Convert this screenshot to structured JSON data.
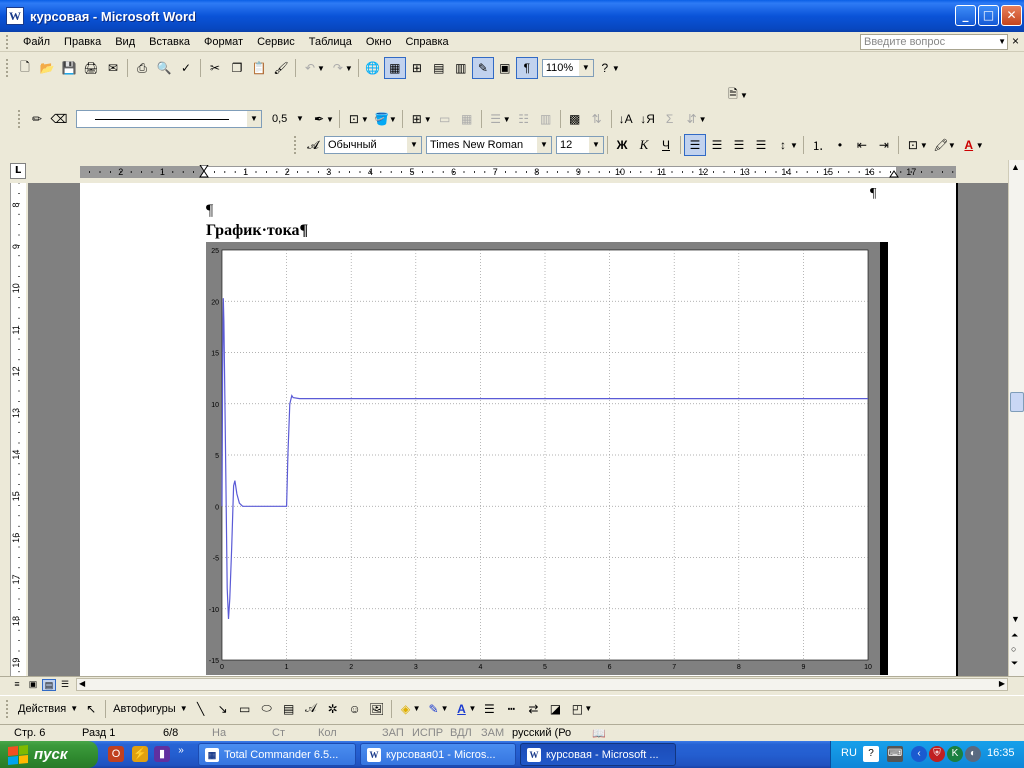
{
  "window": {
    "title": "курсовая - Microsoft Word",
    "controls": [
      "_",
      "□",
      "✕"
    ]
  },
  "menu": {
    "items": [
      "Файл",
      "Правка",
      "Вид",
      "Вставка",
      "Формат",
      "Сервис",
      "Таблица",
      "Окно",
      "Справка"
    ],
    "ask_placeholder": "Введите вопрос"
  },
  "toolbar_standard": {
    "zoom": "110%"
  },
  "toolbar_drawing_lines": {
    "line_weight": "0,5"
  },
  "toolbar_formatting": {
    "style": "Обычный",
    "font": "Times New Roman",
    "size": "12",
    "bold": "Ж",
    "italic": "К",
    "underline": "Ч"
  },
  "ruler": {
    "horizontal_labels": [
      "3",
      "2",
      "1",
      "1",
      "2",
      "3",
      "4",
      "5",
      "6",
      "7",
      "8",
      "9",
      "10",
      "11",
      "12",
      "13",
      "14",
      "15",
      "16",
      "17"
    ],
    "vertical_labels": [
      "8",
      "9",
      "10",
      "11",
      "12",
      "13",
      "14",
      "15",
      "16",
      "17",
      "18",
      "19"
    ]
  },
  "document": {
    "pilcrow": "¶",
    "heading": "График·тока¶"
  },
  "chart_data": {
    "type": "line",
    "xlim": [
      0,
      10
    ],
    "ylim": [
      -15,
      25
    ],
    "x_ticks": [
      "0",
      "1",
      "2",
      "3",
      "4",
      "5",
      "6",
      "7",
      "8",
      "9",
      "10"
    ],
    "y_ticks": [
      "25",
      "20",
      "15",
      "10",
      "5",
      "0",
      "-5",
      "-10",
      "-15"
    ],
    "grid": true,
    "line_color": "#5a5ad6",
    "series": [
      {
        "x": [
          0,
          0.01,
          0.02,
          0.03,
          0.05,
          0.08,
          0.1,
          0.12,
          0.15,
          0.18,
          0.2,
          0.23,
          0.27,
          0.32,
          0.4,
          0.6,
          1.0,
          1.02,
          1.05,
          1.08,
          1.1,
          1.2,
          1.5,
          3,
          5,
          7,
          10
        ],
        "y": [
          0,
          13,
          20.3,
          18,
          8,
          -8,
          -11,
          -9,
          -4,
          2,
          2.5,
          1.2,
          0.3,
          0,
          0,
          0,
          0,
          5,
          10,
          10.8,
          10.6,
          10.5,
          10.5,
          10.5,
          10.5,
          10.5,
          10.5
        ]
      }
    ]
  },
  "drawing_bar": {
    "actions": "Действия",
    "autoshapes": "Автофигуры"
  },
  "status": {
    "page": "Стр. 6",
    "section": "Разд 1",
    "pages": "6/8",
    "at": "На",
    "line": "Ст",
    "col": "Кол",
    "rec": "ЗАП",
    "trk": "ИСПР",
    "ext": "ВДЛ",
    "ovr": "ЗАМ",
    "language": "русский (Ро"
  },
  "taskbar": {
    "start": "пуск",
    "tasks": [
      {
        "label": "Total Commander 6.5..."
      },
      {
        "label": "курсовая01 - Micros..."
      },
      {
        "label": "курсовая - Microsoft ..."
      }
    ],
    "lang": "RU",
    "clock": "16:35"
  }
}
